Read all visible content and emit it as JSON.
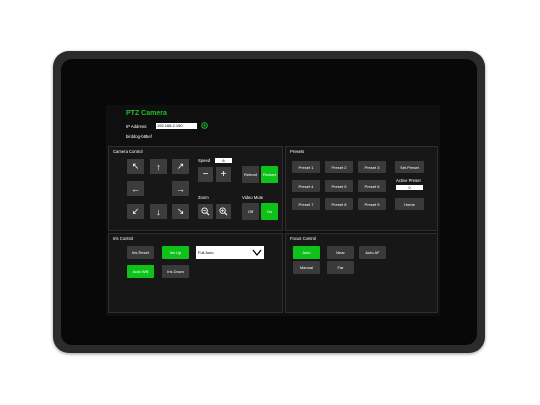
{
  "app": {
    "title": "PTZ Camera",
    "ip_label": "IP Address:",
    "ip_value": "192.168.2.150",
    "hostname": "birddog-b8bef"
  },
  "camera_control": {
    "title": "Camera Control",
    "arrows": [
      {
        "name": "up-left",
        "glyph": "↖"
      },
      {
        "name": "up",
        "glyph": "↑"
      },
      {
        "name": "up-right",
        "glyph": "↗"
      },
      {
        "name": "left",
        "glyph": "←"
      },
      {
        "name": "right",
        "glyph": "→"
      },
      {
        "name": "down-left",
        "glyph": "↙"
      },
      {
        "name": "down",
        "glyph": "↓"
      },
      {
        "name": "down-right",
        "glyph": "↘"
      }
    ],
    "speed_label": "Speed",
    "speed_value": "6",
    "minus_glyph": "−",
    "plus_glyph": "+",
    "reboot_label": "Reboot",
    "restart_label": "Restart",
    "zoom_label": "Zoom",
    "video_mute_label": "Video Mute",
    "off_label": "Off",
    "on_label": "On"
  },
  "presets": {
    "title": "Presets",
    "buttons": [
      "Preset 1",
      "Preset 2",
      "Preset 3",
      "Preset 4",
      "Preset 5",
      "Preset 6",
      "Preset 7",
      "Preset 8",
      "Preset 9"
    ],
    "set_preset_label": "Set Preset",
    "active_preset_label": "Active Preset",
    "active_preset_value": "0",
    "home_label": "Home"
  },
  "iris_control": {
    "title": "Iris Control",
    "iris_reset_label": "Iris Reset",
    "iris_up_label": "Iris Up",
    "iris_down_label": "Iris Down",
    "auto_wb_label": "Auto WB",
    "mode_value": "Full Auto"
  },
  "focus_control": {
    "title": "Focus Control",
    "auto_label": "Auto",
    "near_label": "Near",
    "auto_af_label": "Auto AF",
    "manual_label": "Manual",
    "far_label": "Far"
  },
  "colors": {
    "accent_green": "#0fc21a",
    "title_green": "#1fbf2a",
    "button_gray": "#3a3a3a"
  }
}
